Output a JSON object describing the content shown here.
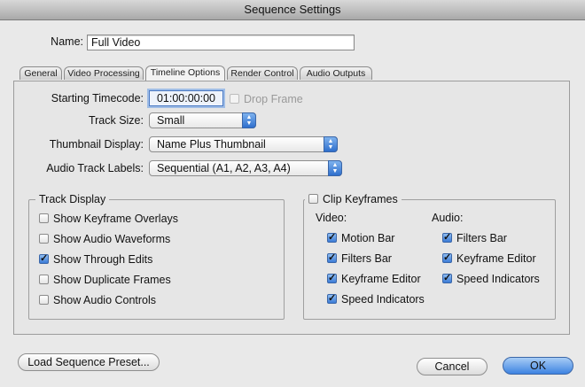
{
  "window": {
    "title": "Sequence Settings"
  },
  "name_field": {
    "label": "Name:",
    "value": "Full Video"
  },
  "tabs": [
    {
      "label": "General",
      "active": false
    },
    {
      "label": "Video Processing",
      "active": false
    },
    {
      "label": "Timeline Options",
      "active": true
    },
    {
      "label": "Render Control",
      "active": false
    },
    {
      "label": "Audio Outputs",
      "active": false
    }
  ],
  "timeline_options": {
    "starting_timecode": {
      "label": "Starting Timecode:",
      "value": "01:00:00:00"
    },
    "drop_frame": {
      "label": "Drop Frame",
      "checked": false,
      "enabled": false
    },
    "track_size": {
      "label": "Track Size:",
      "value": "Small"
    },
    "thumbnail_display": {
      "label": "Thumbnail Display:",
      "value": "Name Plus Thumbnail"
    },
    "audio_track_labels": {
      "label": "Audio Track Labels:",
      "value": "Sequential (A1, A2, A3, A4)"
    }
  },
  "track_display": {
    "title": "Track Display",
    "items": [
      {
        "label": "Show Keyframe Overlays",
        "checked": false
      },
      {
        "label": "Show Audio Waveforms",
        "checked": false
      },
      {
        "label": "Show Through Edits",
        "checked": true
      },
      {
        "label": "Show Duplicate Frames",
        "checked": false
      },
      {
        "label": "Show Audio Controls",
        "checked": false
      }
    ]
  },
  "clip_keyframes": {
    "title": "Clip Keyframes",
    "checked": false,
    "video_heading": "Video:",
    "audio_heading": "Audio:",
    "video_items": [
      {
        "label": "Motion Bar",
        "checked": true
      },
      {
        "label": "Filters Bar",
        "checked": true
      },
      {
        "label": "Keyframe Editor",
        "checked": true
      },
      {
        "label": "Speed Indicators",
        "checked": true
      }
    ],
    "audio_items": [
      {
        "label": "Filters Bar",
        "checked": true
      },
      {
        "label": "Keyframe Editor",
        "checked": true
      },
      {
        "label": "Speed Indicators",
        "checked": true
      }
    ]
  },
  "buttons": {
    "load_preset": "Load Sequence Preset...",
    "cancel": "Cancel",
    "ok": "OK"
  },
  "colors": {
    "accent": "#3d83e1",
    "titlebar": "#b8b8b8",
    "window_bg": "#e6e6e6"
  },
  "icons": {
    "popup_arrows": "updown-arrows-icon",
    "checkmark": "checkmark-icon"
  }
}
